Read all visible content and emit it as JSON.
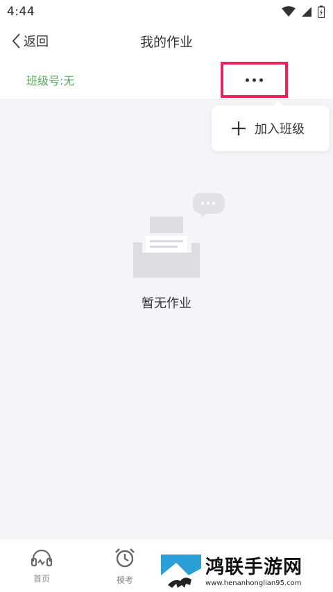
{
  "status_bar": {
    "time": "4:44"
  },
  "nav": {
    "back_label": "返回",
    "title": "我的作业"
  },
  "class_bar": {
    "class_number": "班级号:无"
  },
  "popup": {
    "join_class_label": "加入班级"
  },
  "empty_state": {
    "message": "暂无作业"
  },
  "tabs": [
    {
      "label": "首页",
      "icon": "headphones-icon"
    },
    {
      "label": "模考",
      "icon": "alarm-clock-icon"
    }
  ],
  "watermark": {
    "title": "鸿联手游网",
    "url": "www.henanhonglian95.com"
  },
  "colors": {
    "accent_green": "#5aa860",
    "highlight_red": "#e8245c"
  }
}
